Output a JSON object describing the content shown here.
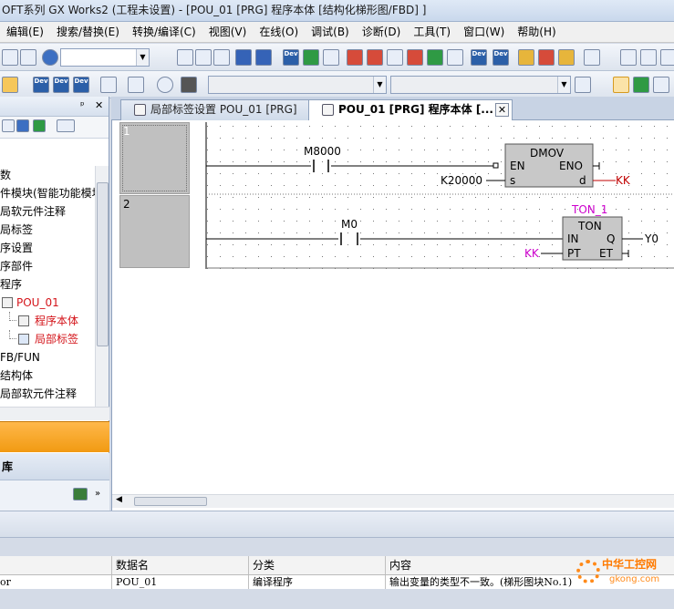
{
  "window": {
    "title": "OFT系列 GX Works2 (工程未设置) - [POU_01 [PRG] 程序本体 [结构化梯形图/FBD] ]"
  },
  "menu": [
    "编辑(E)",
    "搜索/替换(E)",
    "转换/编译(C)",
    "视图(V)",
    "在线(O)",
    "调试(B)",
    "诊断(D)",
    "工具(T)",
    "窗口(W)",
    "帮助(H)"
  ],
  "toolbar": {
    "dev_label": "Dev"
  },
  "navigation": {
    "pin": "ᵖ",
    "close": "✕",
    "tree": [
      {
        "label": "数",
        "level": 0,
        "red": false
      },
      {
        "label": "件模块(智能功能模块",
        "level": 0,
        "red": false
      },
      {
        "label": "局软元件注释",
        "level": 0,
        "red": false
      },
      {
        "label": "局标签",
        "level": 0,
        "red": false
      },
      {
        "label": "序设置",
        "level": 0,
        "red": false
      },
      {
        "label": "序部件",
        "level": 0,
        "red": false
      },
      {
        "label": "程序",
        "level": 0,
        "red": false
      },
      {
        "label": "POU_01",
        "level": 1,
        "red": true
      },
      {
        "label": "程序本体",
        "level": 2,
        "red": true
      },
      {
        "label": "局部标签",
        "level": 2,
        "red": true
      },
      {
        "label": "FB/FUN",
        "level": 0,
        "red": false
      },
      {
        "label": "结构体",
        "level": 0,
        "red": false
      },
      {
        "label": "局部软元件注释",
        "level": 0,
        "red": false
      }
    ],
    "library_label": "库"
  },
  "tabs": [
    {
      "label": "局部标签设置 POU_01 [PRG]",
      "active": false
    },
    {
      "label": "POU_01 [PRG] 程序本体 [...",
      "active": true
    }
  ],
  "tab_close": "✕",
  "ladder": {
    "rung1": {
      "number": "1",
      "contact": "M8000",
      "block": "DMOV",
      "en": "EN",
      "eno": "ENO",
      "s": "s",
      "d": "d",
      "s_value": "K20000",
      "d_value": "KK"
    },
    "rung2": {
      "number": "2",
      "contact": "M0",
      "instance": "TON_1",
      "block": "TON",
      "in": "IN",
      "q": "Q",
      "pt": "PT",
      "et": "ET",
      "pt_value": "KK",
      "q_value": "Y0"
    }
  },
  "output": {
    "columns": [
      "数据名",
      "分类",
      "内容"
    ],
    "rows": [
      {
        "type": "or",
        "data": "POU_01",
        "category": "编译程序",
        "content": "输出变量的类型不一致。(梯形图块No.1)"
      }
    ]
  },
  "watermark": {
    "line1": "中华工控网",
    "line2": "gkong.com"
  },
  "colors": {
    "accent_orange": "#f19a12",
    "label_magenta": "#cc00cc",
    "output_red": "#c00000"
  }
}
